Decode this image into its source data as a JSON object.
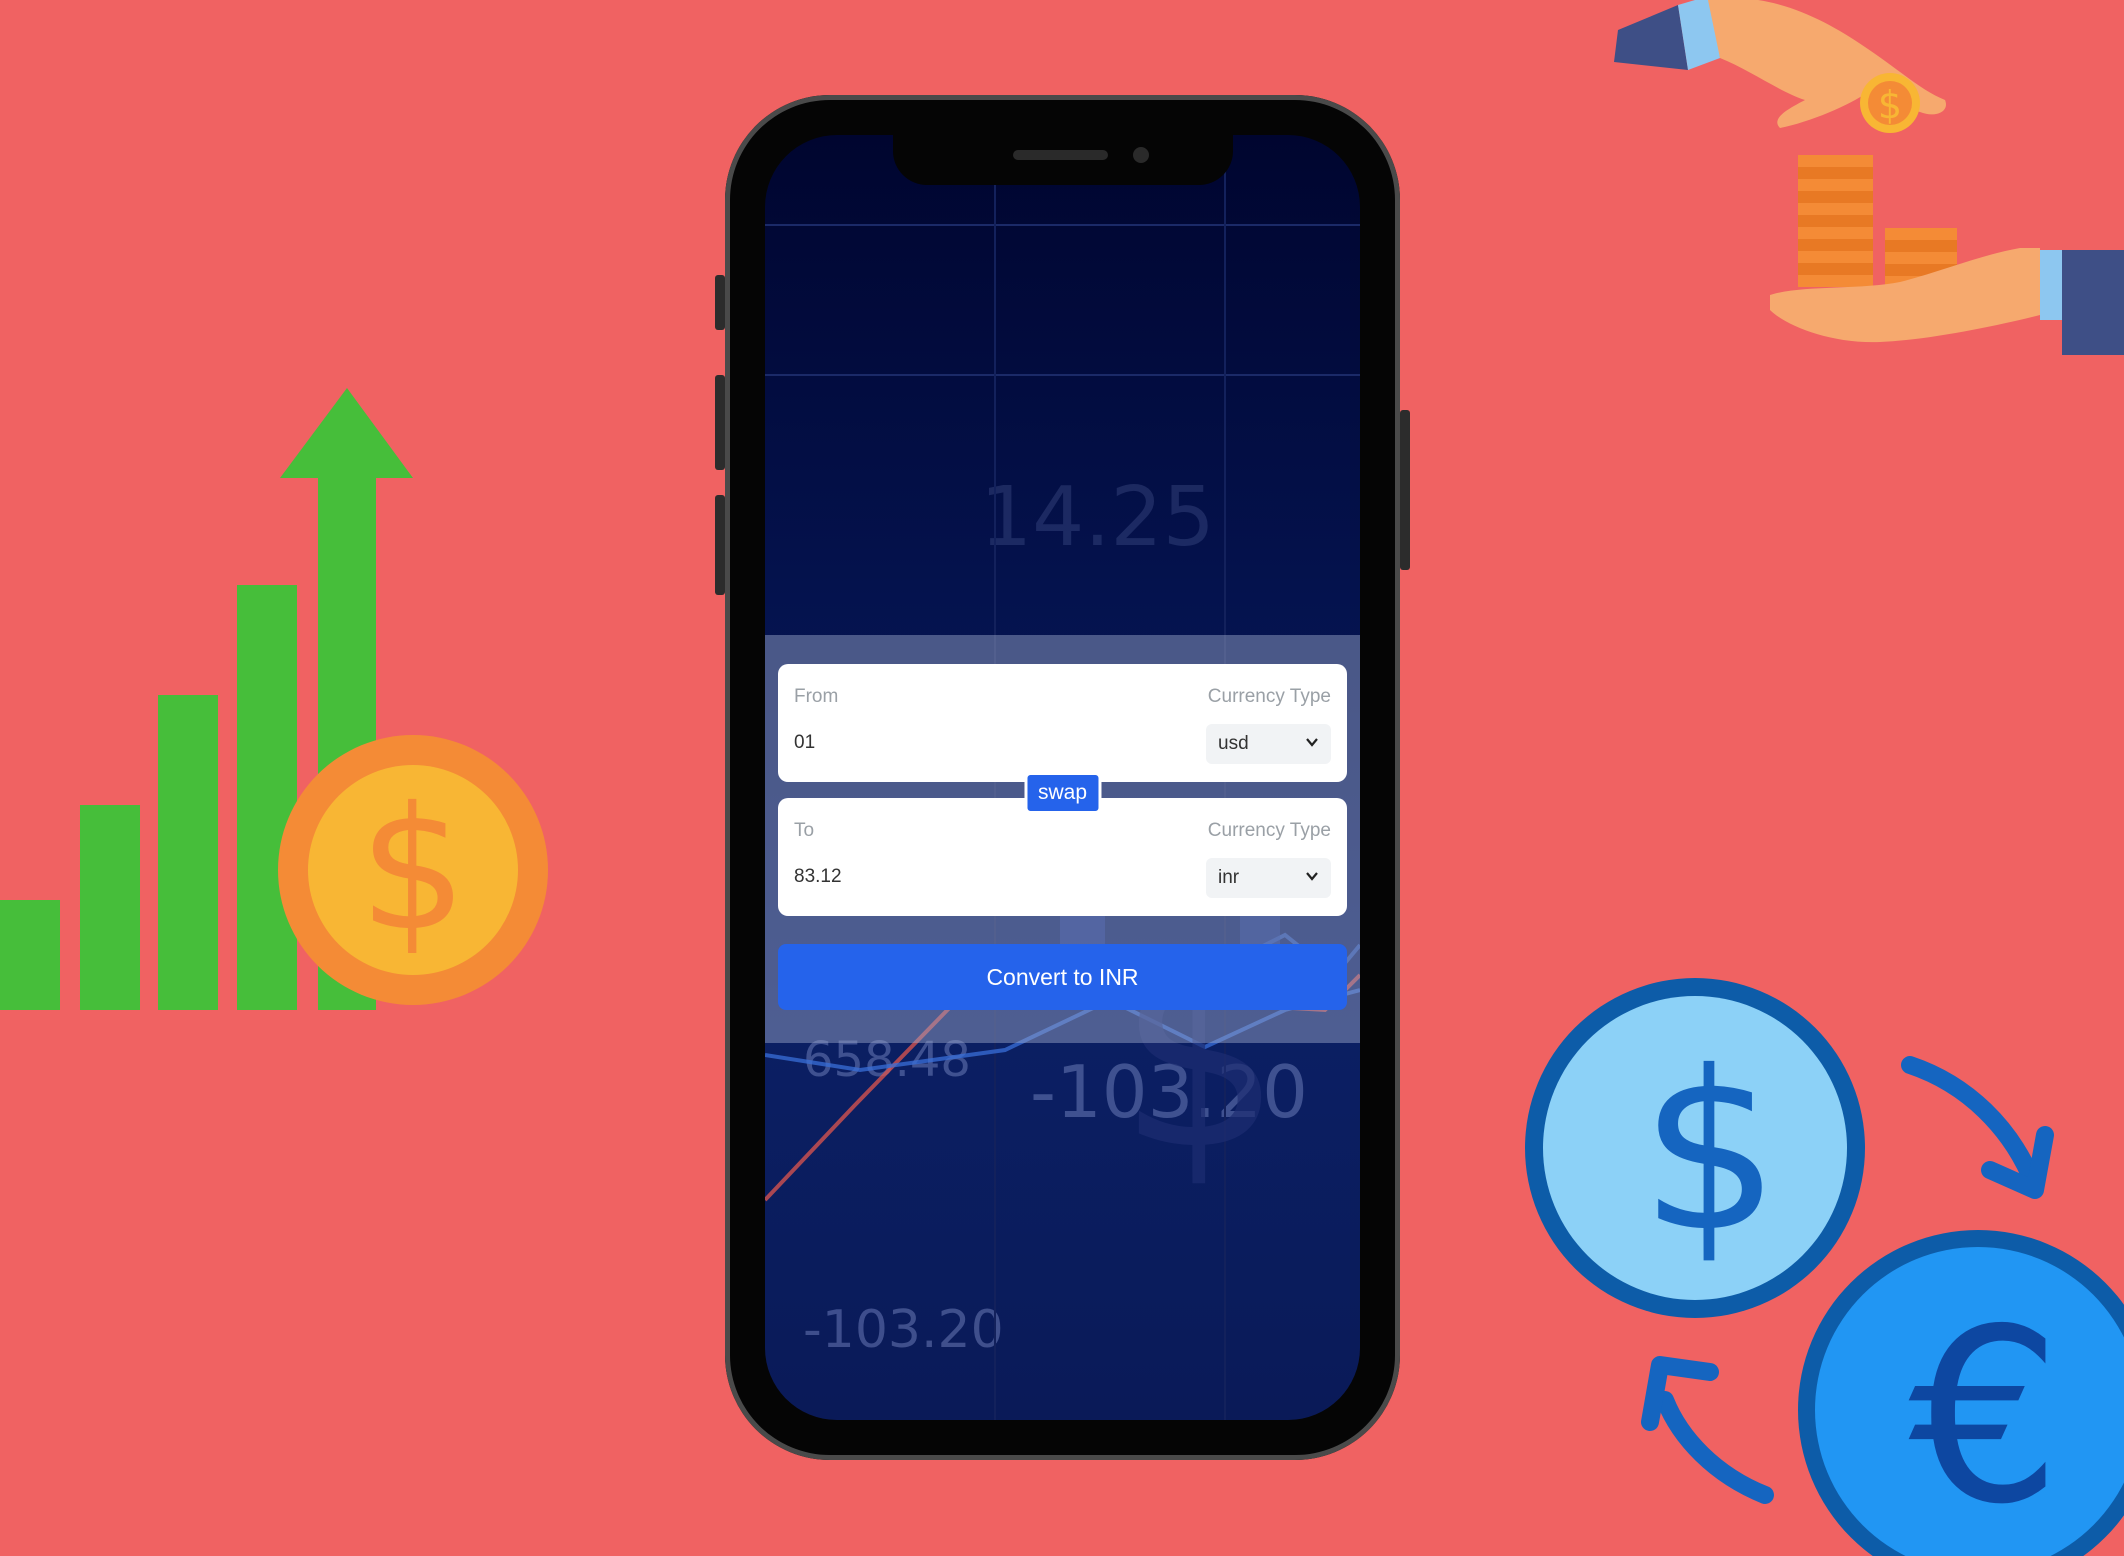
{
  "from_field": {
    "label": "From",
    "value": "01",
    "currency_label": "Currency Type",
    "currency": "usd"
  },
  "swap_label": "swap",
  "to_field": {
    "label": "To",
    "value": "83.12",
    "currency_label": "Currency Type",
    "currency": "inr"
  },
  "convert_label": "Convert to INR",
  "background_numbers": [
    "14.25",
    "658.48",
    "-103.20",
    "-103.20"
  ],
  "colors": {
    "background": "#F06262",
    "accent": "#2563eb"
  }
}
